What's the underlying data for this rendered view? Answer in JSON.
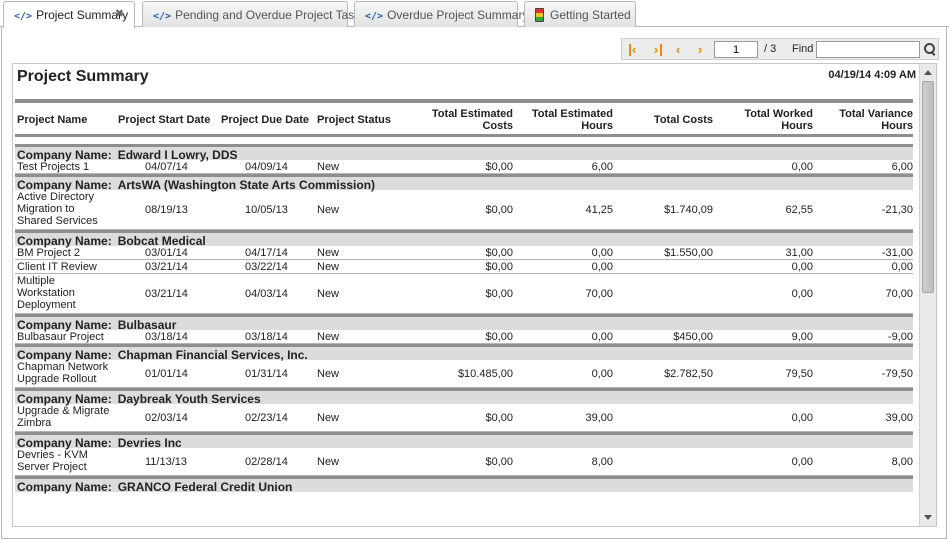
{
  "tabs": [
    {
      "label": "Project Summary",
      "active": true,
      "icon": "code-icon",
      "closable": true
    },
    {
      "label": "Pending and Overdue Project Tasks",
      "active": false,
      "icon": "code-icon"
    },
    {
      "label": "Overdue Project Summary",
      "active": false,
      "icon": "code-icon"
    },
    {
      "label": "Getting Started",
      "active": false,
      "icon": "traffic-light-icon"
    }
  ],
  "toolbar": {
    "page": "1",
    "page_total": "/ 3",
    "find_label": "Find",
    "find_value": ""
  },
  "report": {
    "title": "Project Summary",
    "date": "04/19/14 4:09 AM",
    "columns": [
      "Project Name",
      "Project Start Date",
      "Project Due Date",
      "Project Status",
      "Total Estimated Costs",
      "Total Estimated Hours",
      "Total Costs",
      "Total Worked Hours",
      "Total Variance Hours"
    ],
    "company_prefix": "Company Name:",
    "groups": [
      {
        "company": "Edward I Lowry, DDS",
        "rows": [
          {
            "name": "Test Projects 1",
            "start": "04/07/14",
            "due": "04/09/14",
            "status": "New",
            "est_costs": "$0,00",
            "est_hours": "6,00",
            "costs": "",
            "worked": "0,00",
            "variance": "6,00"
          }
        ]
      },
      {
        "company": "ArtsWA (Washington State Arts Commission)",
        "rows": [
          {
            "name": "Active Directory Migration to Shared Services",
            "start": "08/19/13",
            "due": "10/05/13",
            "status": "New",
            "est_costs": "$0,00",
            "est_hours": "41,25",
            "costs": "$1.740,09",
            "worked": "62,55",
            "variance": "-21,30"
          }
        ]
      },
      {
        "company": "Bobcat Medical",
        "rows": [
          {
            "name": "BM Project 2",
            "start": "03/01/14",
            "due": "04/17/14",
            "status": "New",
            "est_costs": "$0,00",
            "est_hours": "0,00",
            "costs": "$1.550,00",
            "worked": "31,00",
            "variance": "-31,00"
          },
          {
            "name": "Client IT Review",
            "start": "03/21/14",
            "due": "03/22/14",
            "status": "New",
            "est_costs": "$0,00",
            "est_hours": "0,00",
            "costs": "",
            "worked": "0,00",
            "variance": "0,00"
          },
          {
            "name": "Multiple Workstation Deployment",
            "start": "03/21/14",
            "due": "04/03/14",
            "status": "New",
            "est_costs": "$0,00",
            "est_hours": "70,00",
            "costs": "",
            "worked": "0,00",
            "variance": "70,00"
          }
        ]
      },
      {
        "company": "Bulbasaur",
        "rows": [
          {
            "name": "Bulbasaur Project",
            "start": "03/18/14",
            "due": "03/18/14",
            "status": "New",
            "est_costs": "$0,00",
            "est_hours": "0,00",
            "costs": "$450,00",
            "worked": "9,00",
            "variance": "-9,00"
          }
        ]
      },
      {
        "company": "Chapman Financial Services, Inc.",
        "rows": [
          {
            "name": "Chapman Network Upgrade Rollout",
            "start": "01/01/14",
            "due": "01/31/14",
            "status": "New",
            "est_costs": "$10.485,00",
            "est_hours": "0,00",
            "costs": "$2.782,50",
            "worked": "79,50",
            "variance": "-79,50"
          }
        ]
      },
      {
        "company": "Daybreak Youth Services",
        "rows": [
          {
            "name": "Upgrade & Migrate Zimbra",
            "start": "02/03/14",
            "due": "02/23/14",
            "status": "New",
            "est_costs": "$0,00",
            "est_hours": "39,00",
            "costs": "",
            "worked": "0,00",
            "variance": "39,00"
          }
        ]
      },
      {
        "company": "Devries Inc",
        "rows": [
          {
            "name": "Devries -  KVM Server Project",
            "start": "11/13/13",
            "due": "02/28/14",
            "status": "New",
            "est_costs": "$0,00",
            "est_hours": "8,00",
            "costs": "",
            "worked": "0,00",
            "variance": "8,00"
          }
        ]
      },
      {
        "company": "GRANCO Federal Credit Union",
        "rows": []
      }
    ]
  }
}
